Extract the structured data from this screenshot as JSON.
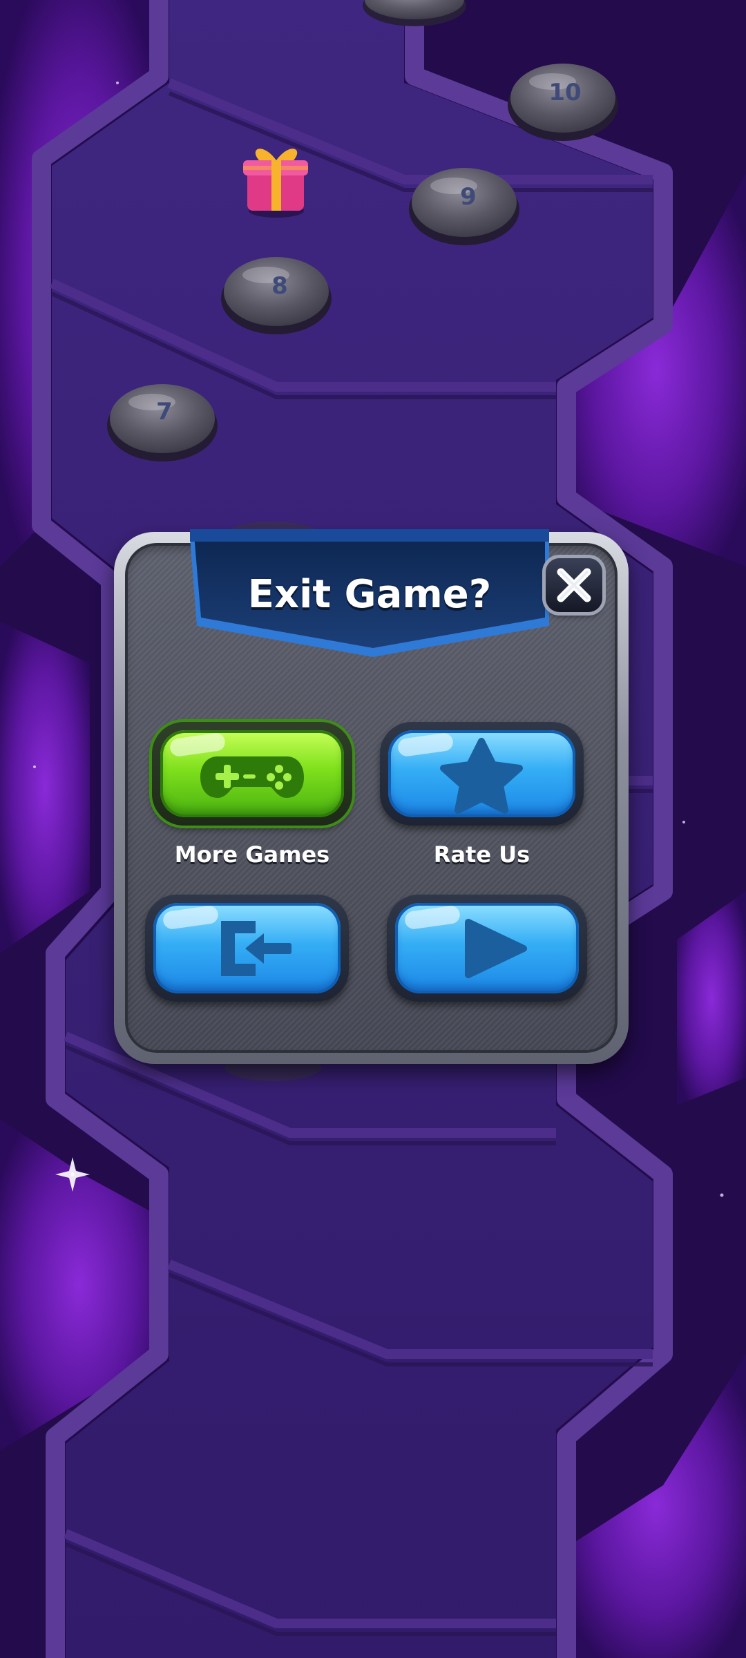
{
  "dialog": {
    "title": "Exit Game?",
    "close_icon": "close-icon"
  },
  "buttons": {
    "more_games": {
      "label": "More Games",
      "icon": "gamepad-icon",
      "color": "#7fe01c"
    },
    "rate_us": {
      "label": "Rate Us",
      "icon": "star-icon",
      "color": "#35aef5"
    },
    "exit": {
      "icon": "exit-door-icon",
      "color": "#35aef5"
    },
    "resume": {
      "icon": "play-icon",
      "color": "#35aef5"
    }
  },
  "map": {
    "levels": [
      "7",
      "8",
      "9",
      "10"
    ],
    "reward_icon": "gift-box-icon",
    "background_color": "#2a0f57",
    "path_color": "#4a2a86"
  }
}
